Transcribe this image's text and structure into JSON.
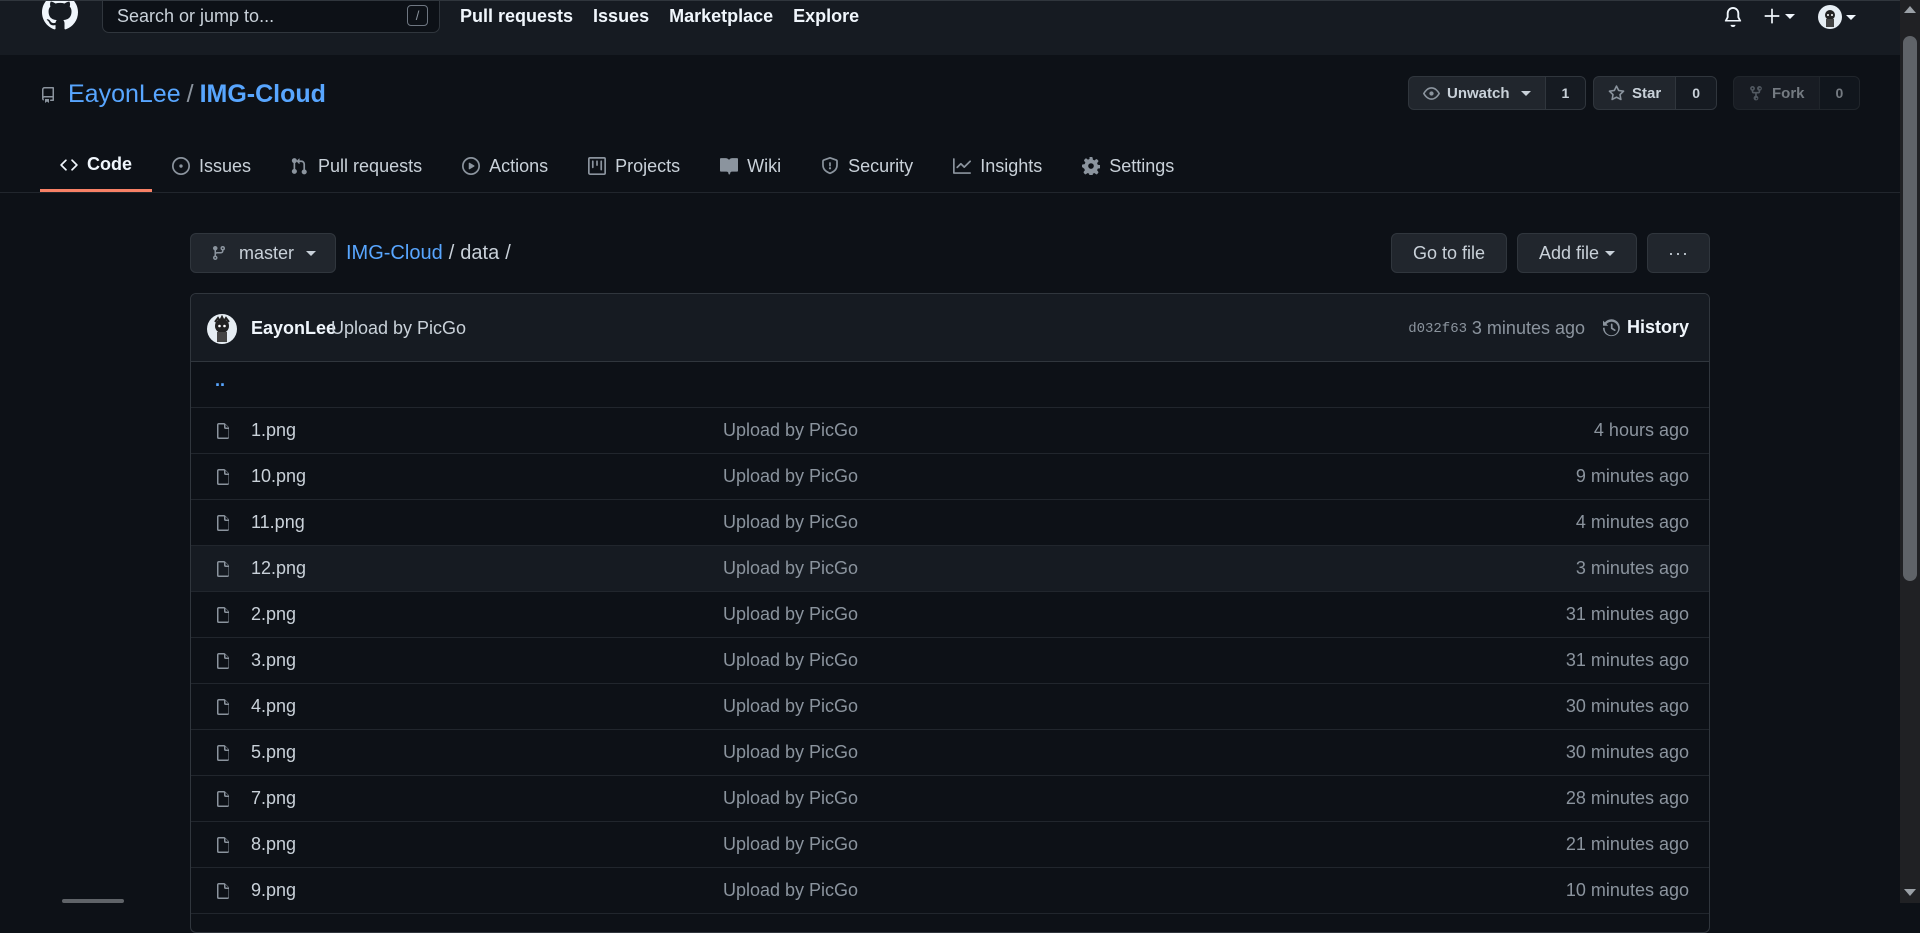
{
  "header": {
    "search_placeholder": "Search or jump to...",
    "search_shortcut": "/",
    "nav": [
      "Pull requests",
      "Issues",
      "Marketplace",
      "Explore"
    ]
  },
  "repo": {
    "owner": "EayonLee",
    "separator": "/",
    "name": "IMG-Cloud",
    "watch_label": "Unwatch",
    "watch_count": "1",
    "star_label": "Star",
    "star_count": "0",
    "fork_label": "Fork",
    "fork_count": "0"
  },
  "tabs": [
    {
      "label": "Code",
      "icon": "code-icon",
      "active": true
    },
    {
      "label": "Issues",
      "icon": "issue-icon"
    },
    {
      "label": "Pull requests",
      "icon": "pull-request-icon"
    },
    {
      "label": "Actions",
      "icon": "play-icon"
    },
    {
      "label": "Projects",
      "icon": "project-icon"
    },
    {
      "label": "Wiki",
      "icon": "book-icon"
    },
    {
      "label": "Security",
      "icon": "shield-icon"
    },
    {
      "label": "Insights",
      "icon": "graph-icon"
    },
    {
      "label": "Settings",
      "icon": "gear-icon"
    }
  ],
  "file_nav": {
    "branch": "master",
    "breadcrumb_repo": "IMG-Cloud",
    "breadcrumb_sep": "/",
    "breadcrumb_path": "data",
    "breadcrumb_trailing": "/",
    "go_to_file": "Go to file",
    "add_file": "Add file",
    "more": "···"
  },
  "latest_commit": {
    "author": "EayonLee",
    "message": "Upload by PicGo",
    "sha": "d032f63",
    "time": "3 minutes ago",
    "history_label": "History"
  },
  "parent_dir": "..",
  "files": [
    {
      "name": "1.png",
      "commit": "Upload by PicGo",
      "time": "4 hours ago"
    },
    {
      "name": "10.png",
      "commit": "Upload by PicGo",
      "time": "9 minutes ago"
    },
    {
      "name": "11.png",
      "commit": "Upload by PicGo",
      "time": "4 minutes ago"
    },
    {
      "name": "12.png",
      "commit": "Upload by PicGo",
      "time": "3 minutes ago"
    },
    {
      "name": "2.png",
      "commit": "Upload by PicGo",
      "time": "31 minutes ago"
    },
    {
      "name": "3.png",
      "commit": "Upload by PicGo",
      "time": "31 minutes ago"
    },
    {
      "name": "4.png",
      "commit": "Upload by PicGo",
      "time": "30 minutes ago"
    },
    {
      "name": "5.png",
      "commit": "Upload by PicGo",
      "time": "30 minutes ago"
    },
    {
      "name": "7.png",
      "commit": "Upload by PicGo",
      "time": "28 minutes ago"
    },
    {
      "name": "8.png",
      "commit": "Upload by PicGo",
      "time": "21 minutes ago"
    },
    {
      "name": "9.png",
      "commit": "Upload by PicGo",
      "time": "10 minutes ago"
    }
  ],
  "colors": {
    "background": "#0d1117",
    "header_bg": "#161b22",
    "link": "#58a6ff",
    "active_tab_underline": "#f78166",
    "text": "#c9d1d9",
    "muted": "#8b949e"
  }
}
